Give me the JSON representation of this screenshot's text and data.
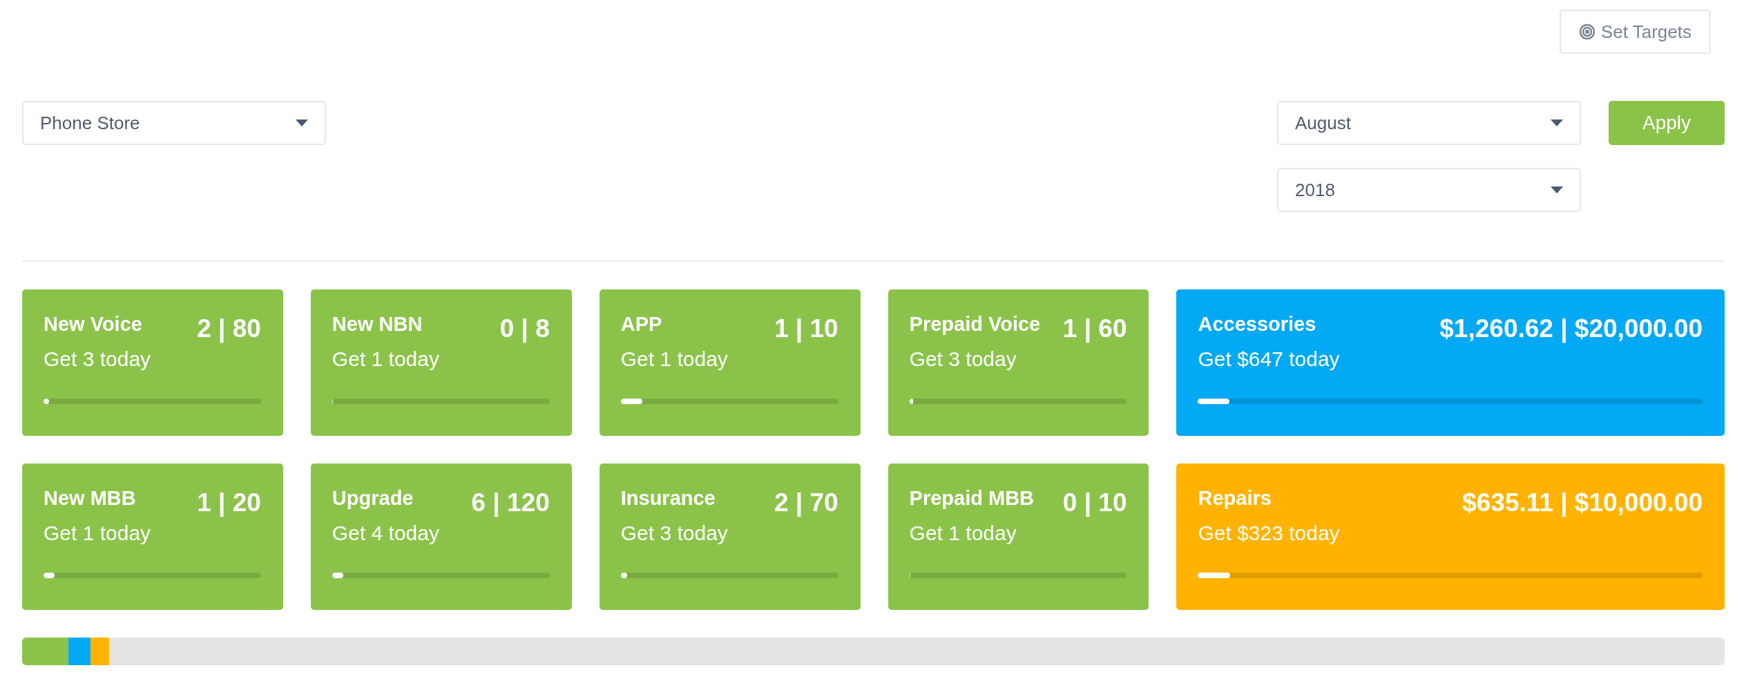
{
  "set_targets_button": {
    "label": "Set Targets"
  },
  "filters": {
    "store": {
      "value": "Phone Store"
    },
    "month": {
      "value": "August"
    },
    "year": {
      "value": "2018"
    },
    "apply_button": {
      "label": "Apply"
    }
  },
  "cards": [
    {
      "title": "New Voice",
      "value": "2 | 80",
      "subtitle": "Get 3 today",
      "level": 0.025,
      "color": "#8bc34a"
    },
    {
      "title": "New NBN",
      "value": "0 | 8",
      "subtitle": "Get 1 today",
      "level": 0,
      "color": "#8bc34a"
    },
    {
      "title": "APP",
      "value": "1 | 10",
      "subtitle": "Get 1 today",
      "level": 0.1,
      "color": "#8bc34a"
    },
    {
      "title": "Prepaid Voice",
      "value": "1 | 60",
      "subtitle": "Get 3 today",
      "level": 0.017,
      "color": "#8bc34a"
    },
    {
      "title": "Accessories",
      "value": "$1,260.62 | $20,000.00",
      "subtitle": "Get $647 today",
      "level": 0.063,
      "color": "#03a9f4"
    },
    {
      "title": "New MBB",
      "value": "1 | 20",
      "subtitle": "Get 1 today",
      "level": 0.05,
      "color": "#8bc34a"
    },
    {
      "title": "Upgrade",
      "value": "6 | 120",
      "subtitle": "Get 4 today",
      "level": 0.05,
      "color": "#8bc34a"
    },
    {
      "title": "Insurance",
      "value": "2 | 70",
      "subtitle": "Get 3 today",
      "level": 0.029,
      "color": "#8bc34a"
    },
    {
      "title": "Prepaid MBB",
      "value": "0 | 10",
      "subtitle": "Get 1 today",
      "level": 0,
      "color": "#8bc34a"
    },
    {
      "title": "Repairs",
      "value": "$635.11 | $10,000.00",
      "subtitle": "Get $323 today",
      "level": 0.0635,
      "color": "#ffb300"
    }
  ],
  "overall_bar": {
    "segments": [
      {
        "color": "#8bc34a",
        "level": 0.027
      },
      {
        "color": "#03a9f4",
        "level": 0.013
      },
      {
        "color": "#ffb300",
        "level": 0.011
      }
    ]
  }
}
